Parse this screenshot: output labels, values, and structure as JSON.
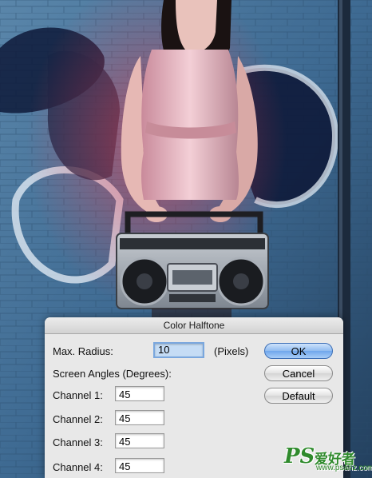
{
  "background": {
    "description_icon": "photo-woman-with-boombox",
    "colors": {
      "wall": "#3e6a92",
      "wall_dark": "#1f3a5a",
      "graffiti": "#0e1a3a",
      "dress": "#e3b6c0",
      "boombox": "#9aa2ac",
      "hair": "#1a1212"
    }
  },
  "dialog": {
    "title": "Color Halftone",
    "max_radius": {
      "label": "Max. Radius:",
      "value": "10",
      "unit": "(Pixels)"
    },
    "screen_angles_label": "Screen Angles (Degrees):",
    "channels": [
      {
        "label": "Channel 1:",
        "value": "45"
      },
      {
        "label": "Channel 2:",
        "value": "45"
      },
      {
        "label": "Channel 3:",
        "value": "45"
      },
      {
        "label": "Channel 4:",
        "value": "45"
      }
    ],
    "buttons": {
      "ok": "OK",
      "cancel": "Cancel",
      "default": "Default"
    },
    "accent_color": "#7aa7de"
  },
  "watermark": {
    "logo": "PS",
    "site_name": "爱好者",
    "url": "www.psahz.com"
  }
}
